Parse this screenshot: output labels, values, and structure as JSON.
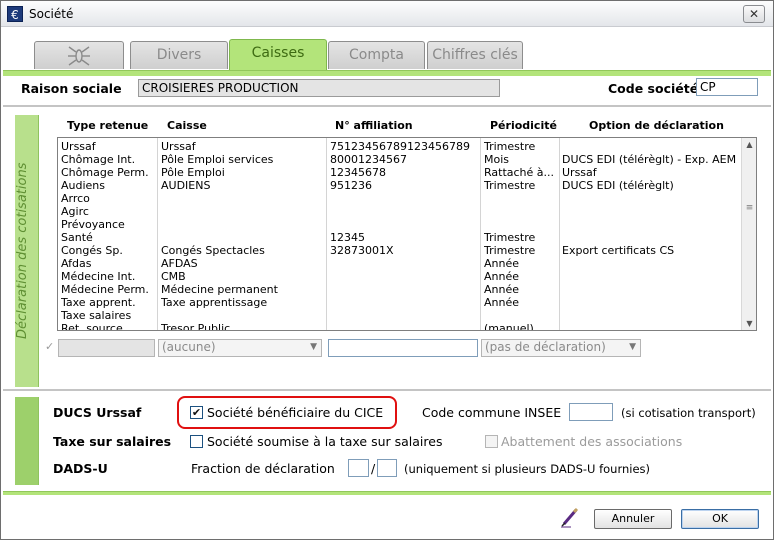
{
  "window": {
    "title": "Société",
    "close_glyph": "✕"
  },
  "tabs": [
    {
      "label": "",
      "icon": "insect-icon",
      "active": false
    },
    {
      "label": "Divers",
      "active": false
    },
    {
      "label": "Caisses",
      "active": true
    },
    {
      "label": "Compta",
      "active": false
    },
    {
      "label": "Chiffres clés",
      "active": false
    }
  ],
  "header": {
    "raison_label": "Raison sociale",
    "raison_value": "CROISIERES PRODUCTION",
    "code_label": "Code société",
    "code_value": "CP"
  },
  "declaration": {
    "side_label": "Déclaration des cotisations",
    "columns": [
      "Type retenue",
      "Caisse",
      "N° affiliation",
      "Périodicité",
      "Option de déclaration"
    ],
    "rows": [
      [
        "Urssaf",
        "Urssaf",
        "75123456789123456789",
        "Trimestre",
        ""
      ],
      [
        "Chômage Int.",
        "Pôle Emploi services",
        "80001234567",
        "Mois",
        "DUCS EDI (télérèglt) - Exp. AEM"
      ],
      [
        "Chômage Perm.",
        "Pôle Emploi",
        "12345678",
        "Rattaché à...",
        "Urssaf"
      ],
      [
        "Audiens",
        "AUDIENS",
        "951236",
        "Trimestre",
        "DUCS EDI (télérèglt)"
      ],
      [
        "Arrco",
        "",
        "",
        "",
        ""
      ],
      [
        "Agirc",
        "",
        "",
        "",
        ""
      ],
      [
        "Prévoyance",
        "",
        "",
        "",
        ""
      ],
      [
        "Santé",
        "",
        "12345",
        "Trimestre",
        ""
      ],
      [
        "Congés Sp.",
        "Congés Spectacles",
        "32873001X",
        "Trimestre",
        "Export certificats CS"
      ],
      [
        "Afdas",
        "AFDAS",
        "",
        "Année",
        ""
      ],
      [
        "Médecine Int.",
        "CMB",
        "",
        "Année",
        ""
      ],
      [
        "Médecine Perm.",
        "Médecine permanent",
        "",
        "Année",
        ""
      ],
      [
        "Taxe apprent.",
        "Taxe apprentissage",
        "",
        "Année",
        ""
      ],
      [
        "Taxe salaires",
        "",
        "",
        "",
        ""
      ],
      [
        "Ret. source",
        "Tresor Public",
        "",
        "(manuel)",
        ""
      ]
    ],
    "filter_caisse": "(aucune)",
    "filter_option": "(pas de déclaration)"
  },
  "ducs": {
    "label": "DUCS Urssaf",
    "cice_label": "Société bénéficiaire du CICE",
    "cice_checked": true,
    "insee_label": "Code commune INSEE",
    "insee_value": "",
    "insee_note": "(si cotisation transport)"
  },
  "taxe": {
    "label": "Taxe sur salaires",
    "soumise_label": "Société soumise à la taxe sur salaires",
    "soumise_checked": false,
    "abattement_label": "Abattement des associations",
    "abattement_checked": false
  },
  "dadsu": {
    "label": "DADS-U",
    "fraction_label": "Fraction de déclaration",
    "fraction_num": "",
    "fraction_sep": "/",
    "fraction_den": "",
    "note": "(uniquement si plusieurs DADS-U fournies)"
  },
  "buttons": {
    "cancel": "Annuler",
    "ok": "OK"
  },
  "colors": {
    "accent_green": "#b3e47a",
    "highlight_red": "#e01010"
  }
}
